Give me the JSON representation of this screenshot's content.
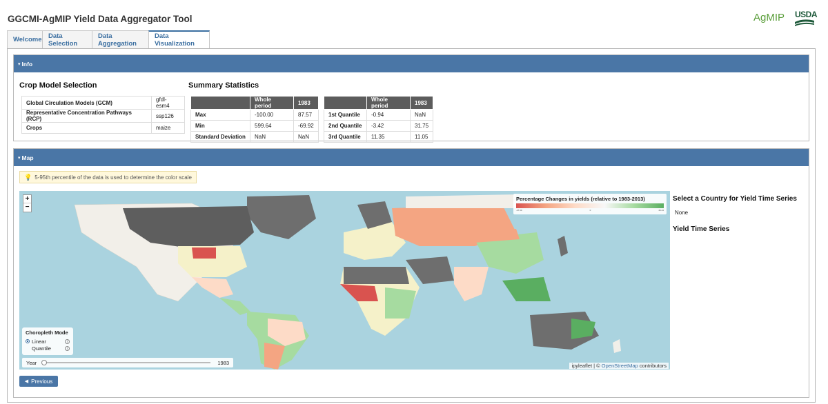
{
  "app": {
    "title": "GGCMI-AgMIP Yield Data Aggregator Tool"
  },
  "logos": {
    "agmip": "AgMIP",
    "usda": "USDA"
  },
  "tabs": [
    {
      "label": "Welcome"
    },
    {
      "label": "Data Selection"
    },
    {
      "label": "Data Aggregation"
    },
    {
      "label": "Data Visualization"
    }
  ],
  "info_panel": {
    "header": "Info",
    "crop_model": {
      "title": "Crop Model Selection",
      "rows": [
        {
          "key": "Global Circulation Models (GCM)",
          "value": "gfdl-esm4"
        },
        {
          "key": "Representative Concentration Pathways (RCP)",
          "value": "ssp126"
        },
        {
          "key": "Crops",
          "value": "maize"
        }
      ]
    },
    "summary": {
      "title": "Summary Statistics",
      "col_whole": "Whole period",
      "col_year": "1983",
      "left_rows": [
        {
          "key": "Max",
          "whole": "-100.00",
          "year": "87.57"
        },
        {
          "key": "Min",
          "whole": "599.64",
          "year": "-69.92"
        },
        {
          "key": "Standard Deviation",
          "whole": "NaN",
          "year": "NaN"
        }
      ],
      "right_rows": [
        {
          "key": "1st Quantile",
          "whole": "-0.94",
          "year": "NaN"
        },
        {
          "key": "2nd Quantile",
          "whole": "-3.42",
          "year": "31.75"
        },
        {
          "key": "3rd Quantile",
          "whole": "11.35",
          "year": "11.05"
        }
      ]
    }
  },
  "map_panel": {
    "header": "Map",
    "note": "5-95th percentile of the data is used to determine the color scale",
    "zoom_in": "+",
    "zoom_out": "−",
    "legend": {
      "title": "Percentage Changes in yields (relative to 1983-2013)",
      "min": "-27.30",
      "mid": "0",
      "max": "26.44"
    },
    "choropleth": {
      "title": "Choropleth Mode",
      "options": [
        {
          "label": "Linear",
          "selected": true
        },
        {
          "label": "Quantile",
          "selected": false
        }
      ],
      "info_glyph": "i"
    },
    "year": {
      "label": "Year",
      "value": "1983"
    },
    "attribution": {
      "prefix": "ipyleaflet | © ",
      "link": "OpenStreetMap",
      "suffix": " contributors"
    },
    "side": {
      "select_title": "Select a Country for Yield Time Series",
      "select_value": "None",
      "series_title": "Yield Time Series"
    },
    "colors": {
      "ocean": "#aad3df",
      "land": "#f2efe9",
      "no_data": "#6e6e6e",
      "strong_red": "#d9534f",
      "light_red": "#f4a582",
      "pale": "#fddbc7",
      "light_green": "#a6dba0",
      "green": "#5aae61"
    }
  },
  "buttons": {
    "previous": "Previous"
  }
}
